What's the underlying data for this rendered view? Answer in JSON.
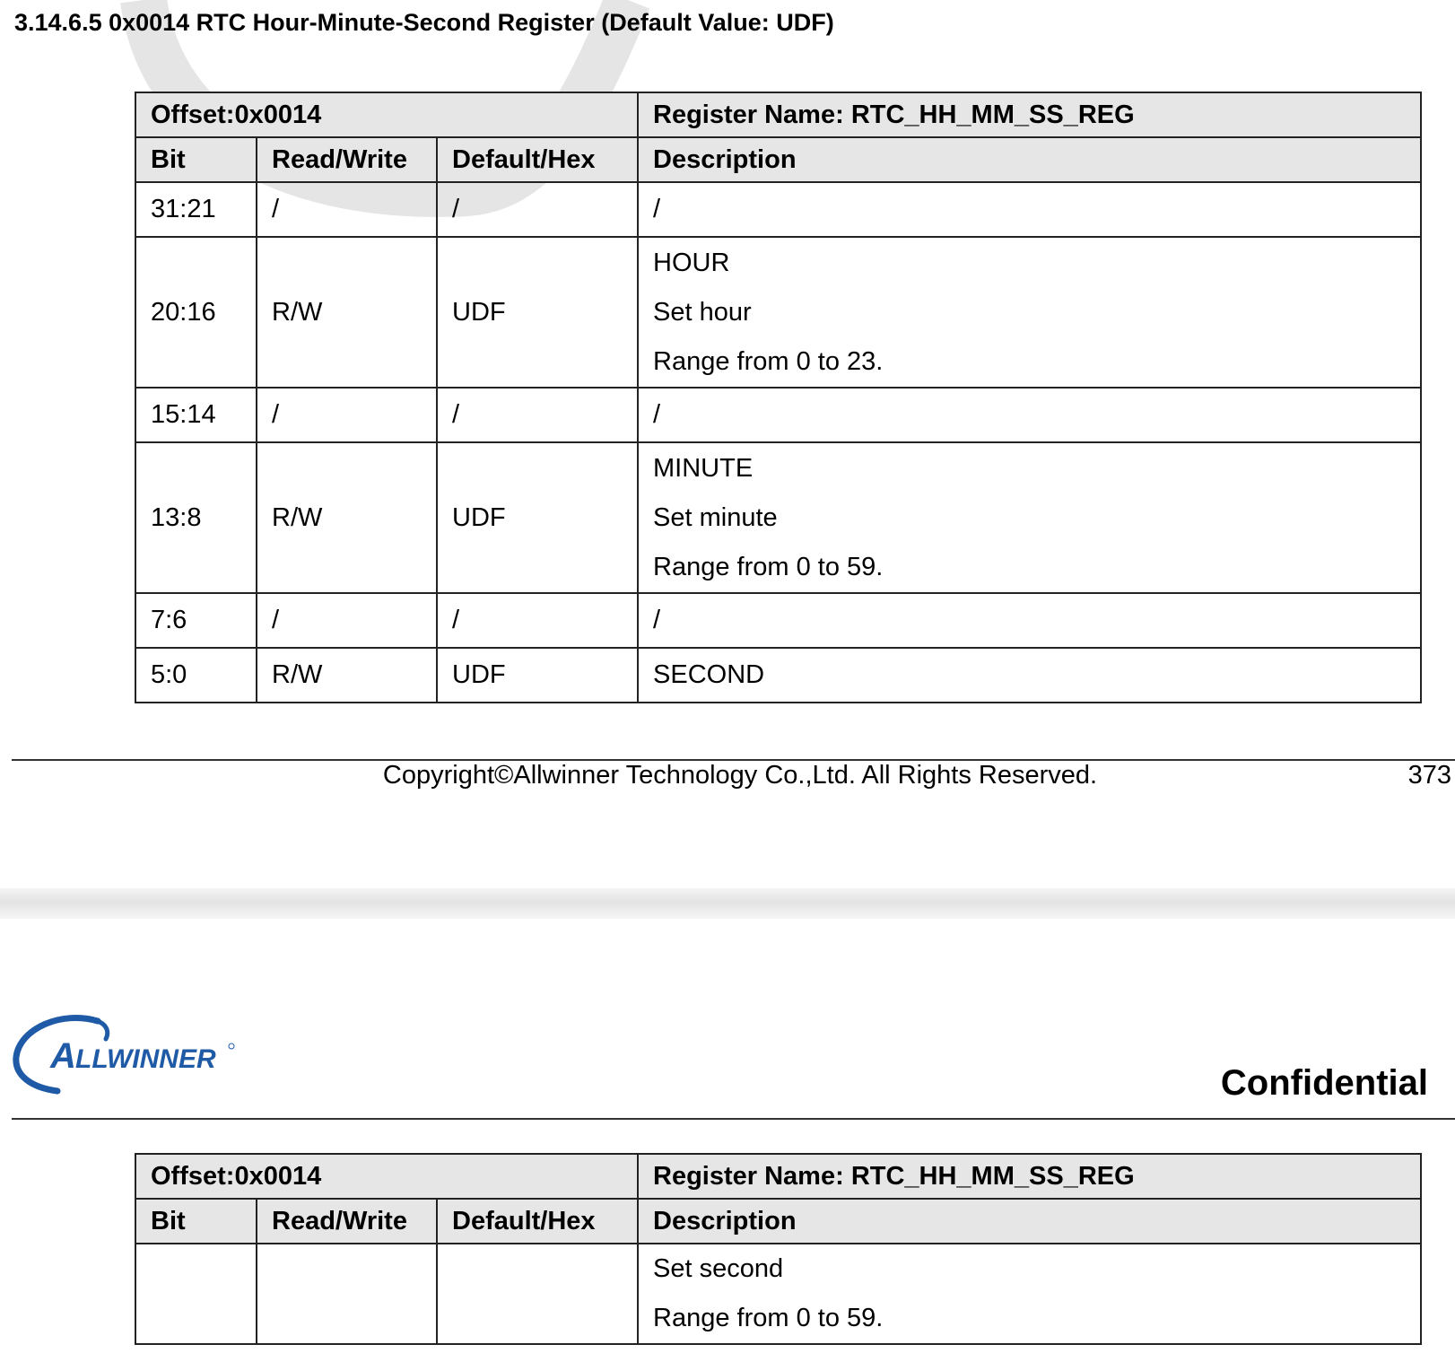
{
  "document": {
    "section_title": "3.14.6.5  0x0014 RTC Hour-Minute-Second Register (Default Value: UDF)"
  },
  "register_table": {
    "offset_label": "Offset:0x0014",
    "name_label": "Register Name: RTC_HH_MM_SS_REG",
    "columns": [
      "Bit",
      "Read/Write",
      "Default/Hex",
      "Description"
    ],
    "rows": [
      {
        "bit": "31:21",
        "rw": "/",
        "default": "/",
        "desc": [
          "/"
        ]
      },
      {
        "bit": "20:16",
        "rw": "R/W",
        "default": "UDF",
        "desc": [
          "HOUR",
          "Set hour",
          "Range from 0 to 23."
        ]
      },
      {
        "bit": "15:14",
        "rw": "/",
        "default": "/",
        "desc": [
          "/"
        ]
      },
      {
        "bit": "13:8",
        "rw": "R/W",
        "default": "UDF",
        "desc": [
          "MINUTE",
          "Set minute",
          "Range from 0 to 59."
        ]
      },
      {
        "bit": "7:6",
        "rw": "/",
        "default": "/",
        "desc": [
          "/"
        ]
      },
      {
        "bit": "5:0",
        "rw": "R/W",
        "default": "UDF",
        "desc": [
          "SECOND"
        ]
      }
    ],
    "continuation_row": {
      "bit": "",
      "rw": "",
      "default": "",
      "desc": [
        "Set second",
        "Range from 0 to 59."
      ]
    }
  },
  "footer": {
    "copyright": "Copyright©Allwinner Technology Co.,Ltd. All Rights Reserved.",
    "page_number": "373"
  },
  "header": {
    "logo_text": "ALLWINNER",
    "confidential": "Confidential"
  },
  "colors": {
    "header_bg": "#e6e6e6",
    "logo_blue": "#1f5aa6",
    "watermark": "#d0d0d0"
  }
}
